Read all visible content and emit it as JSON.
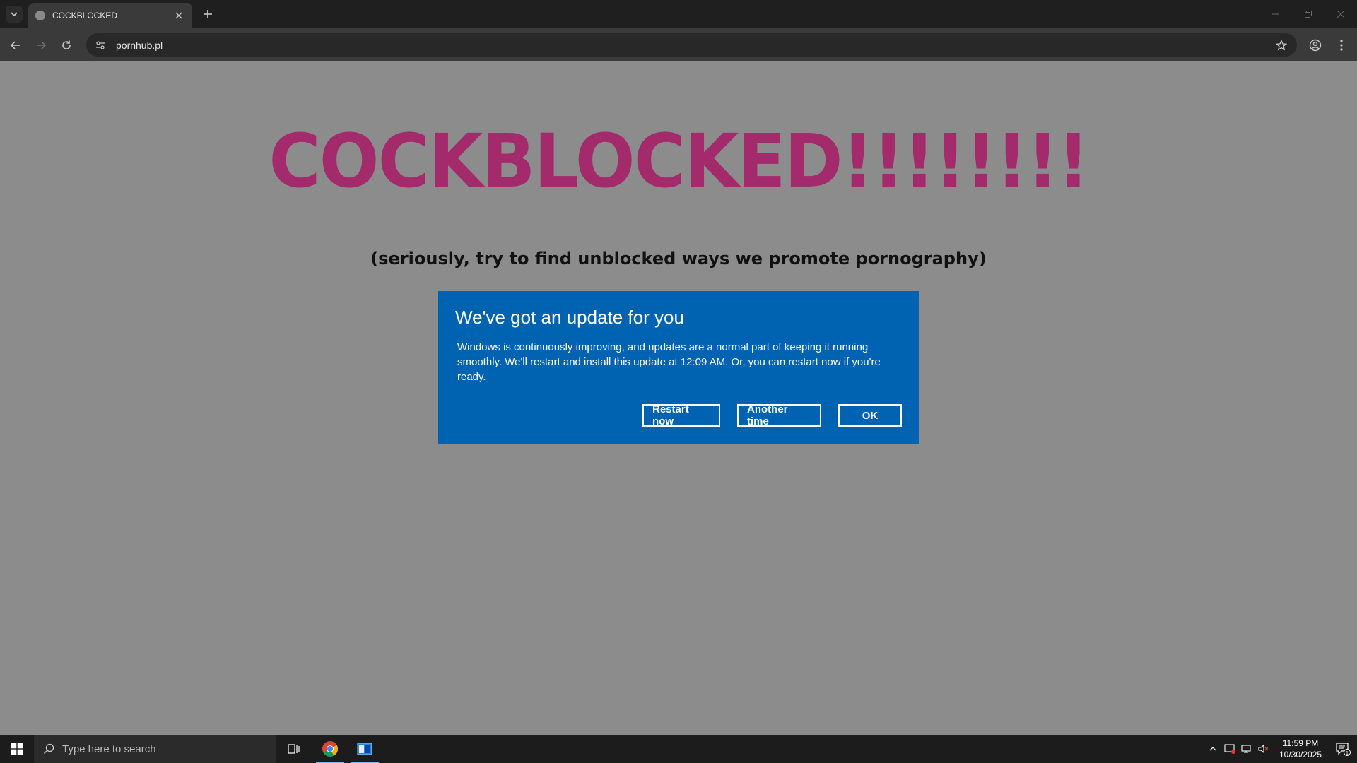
{
  "browser": {
    "tab_title": "COCKBLOCKED",
    "url": "pornhub.pl"
  },
  "page": {
    "headline": "COCKBLOCKED!!!!!!!!",
    "subheadline": "(seriously, try to find unblocked ways we promote pornography)",
    "headline_color": "#a32a6b",
    "background_color": "#8c8c8c"
  },
  "dialog": {
    "title": "We've got an update for you",
    "body": "Windows is continuously improving, and updates are a normal part of keeping it running smoothly. We'll restart and install this update at 12:09 AM. Or, you can restart now if you're ready.",
    "buttons": {
      "restart": "Restart now",
      "another": "Another time",
      "ok": "OK"
    },
    "color": "#0063b1"
  },
  "taskbar": {
    "search_placeholder": "Type here to search",
    "time": "11:59 PM",
    "date": "10/30/2025",
    "notification_count": "1"
  }
}
